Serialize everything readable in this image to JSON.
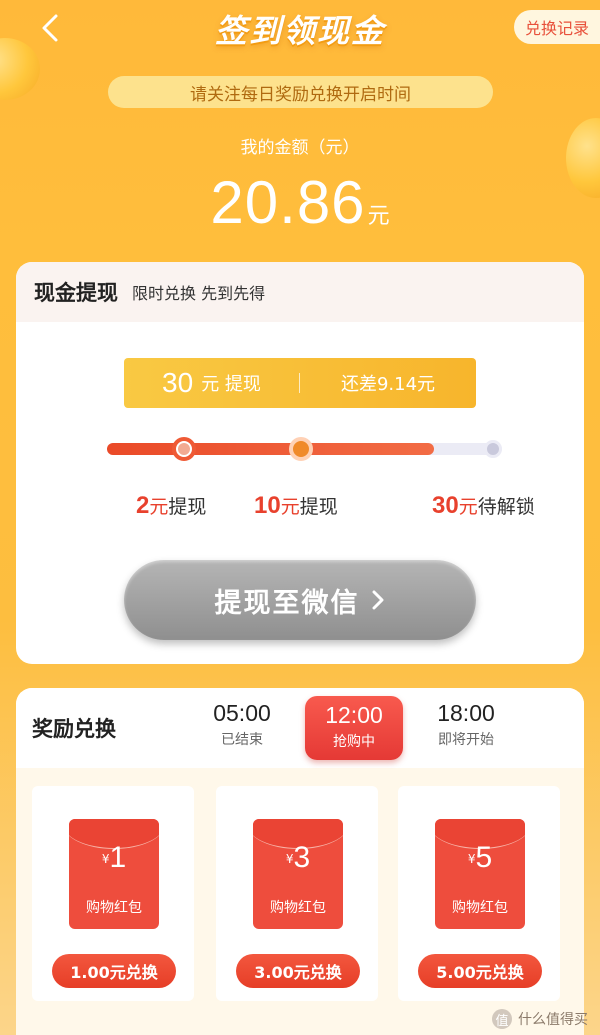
{
  "header": {
    "title": "签到领现金",
    "history_label": "兑换记录"
  },
  "notice": "请关注每日奖励兑换开启时间",
  "balance": {
    "label": "我的金额（元）",
    "value": "20.86",
    "unit": "元"
  },
  "cash": {
    "title": "现金提现",
    "subtitle": "限时兑换 先到先得",
    "tip": {
      "target_num": "30",
      "target_text": "元 提现",
      "remaining": "还差9.14元"
    },
    "progress": {
      "fraction": 0.827
    },
    "milestones": [
      {
        "num": "2",
        "unit": "元",
        "text": "提现",
        "state": "done"
      },
      {
        "num": "10",
        "unit": "元",
        "text": "提现",
        "state": "current"
      },
      {
        "num": "30",
        "unit": "元",
        "text": "待解锁",
        "state": "locked"
      }
    ],
    "withdraw_label": "提现至微信"
  },
  "reward": {
    "title": "奖励兑换",
    "slots": [
      {
        "time": "05:00",
        "status": "已结束"
      },
      {
        "time": "12:00",
        "status": "抢购中"
      },
      {
        "time": "18:00",
        "status": "即将开始"
      }
    ],
    "packs": [
      {
        "yen": "¥",
        "value": "1",
        "label": "购物红包",
        "button": "1.00元兑换"
      },
      {
        "yen": "¥",
        "value": "3",
        "label": "购物红包",
        "button": "3.00元兑换"
      },
      {
        "yen": "¥",
        "value": "5",
        "label": "购物红包",
        "button": "5.00元兑换"
      }
    ]
  },
  "watermark": {
    "icon": "值",
    "text": "什么值得买"
  },
  "colors": {
    "background": "#ffb93a",
    "accent_red": "#e8412d",
    "progress_fill": "#ea4a28",
    "button_disabled": "#a3a3a3"
  }
}
